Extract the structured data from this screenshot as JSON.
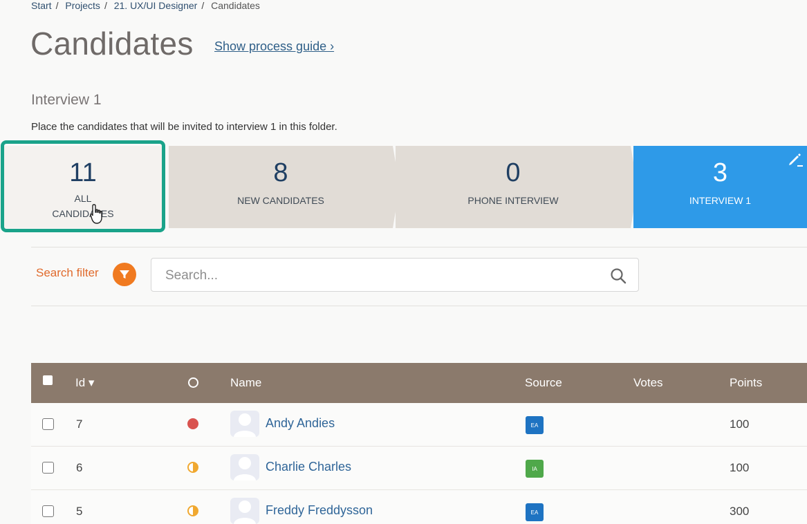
{
  "breadcrumb": [
    "Start",
    "Projects",
    "21. UX/UI Designer",
    "Candidates"
  ],
  "page_title": "Candidates",
  "guide_link": "Show process guide ›",
  "section": {
    "title": "Interview 1",
    "description": "Place the candidates that will be invited to interview 1 in this folder."
  },
  "folders": [
    {
      "count": "11",
      "label": "ALL CANDIDATES"
    },
    {
      "count": "8",
      "label": "NEW CANDIDATES"
    },
    {
      "count": "0",
      "label": "PHONE INTERVIEW"
    },
    {
      "count": "3",
      "label": "INTERVIEW 1"
    }
  ],
  "filter": {
    "label": "Search filter",
    "placeholder": "Search..."
  },
  "table": {
    "headers": {
      "id": "Id ▾",
      "name": "Name",
      "source": "Source",
      "votes": "Votes",
      "points": "Points"
    },
    "rows": [
      {
        "id": "7",
        "name": "Andy Andies",
        "source": "EA",
        "points": "100",
        "status": "red"
      },
      {
        "id": "6",
        "name": "Charlie Charles",
        "source": "IA",
        "points": "100",
        "status": "half"
      },
      {
        "id": "5",
        "name": "Freddy Freddysson",
        "source": "EA",
        "points": "300",
        "status": "half"
      }
    ]
  },
  "colors": {
    "accent": "#2e9ae8",
    "highlight": "#1aa38a",
    "filter": "#f07a20",
    "header": "#8b7a6c"
  }
}
